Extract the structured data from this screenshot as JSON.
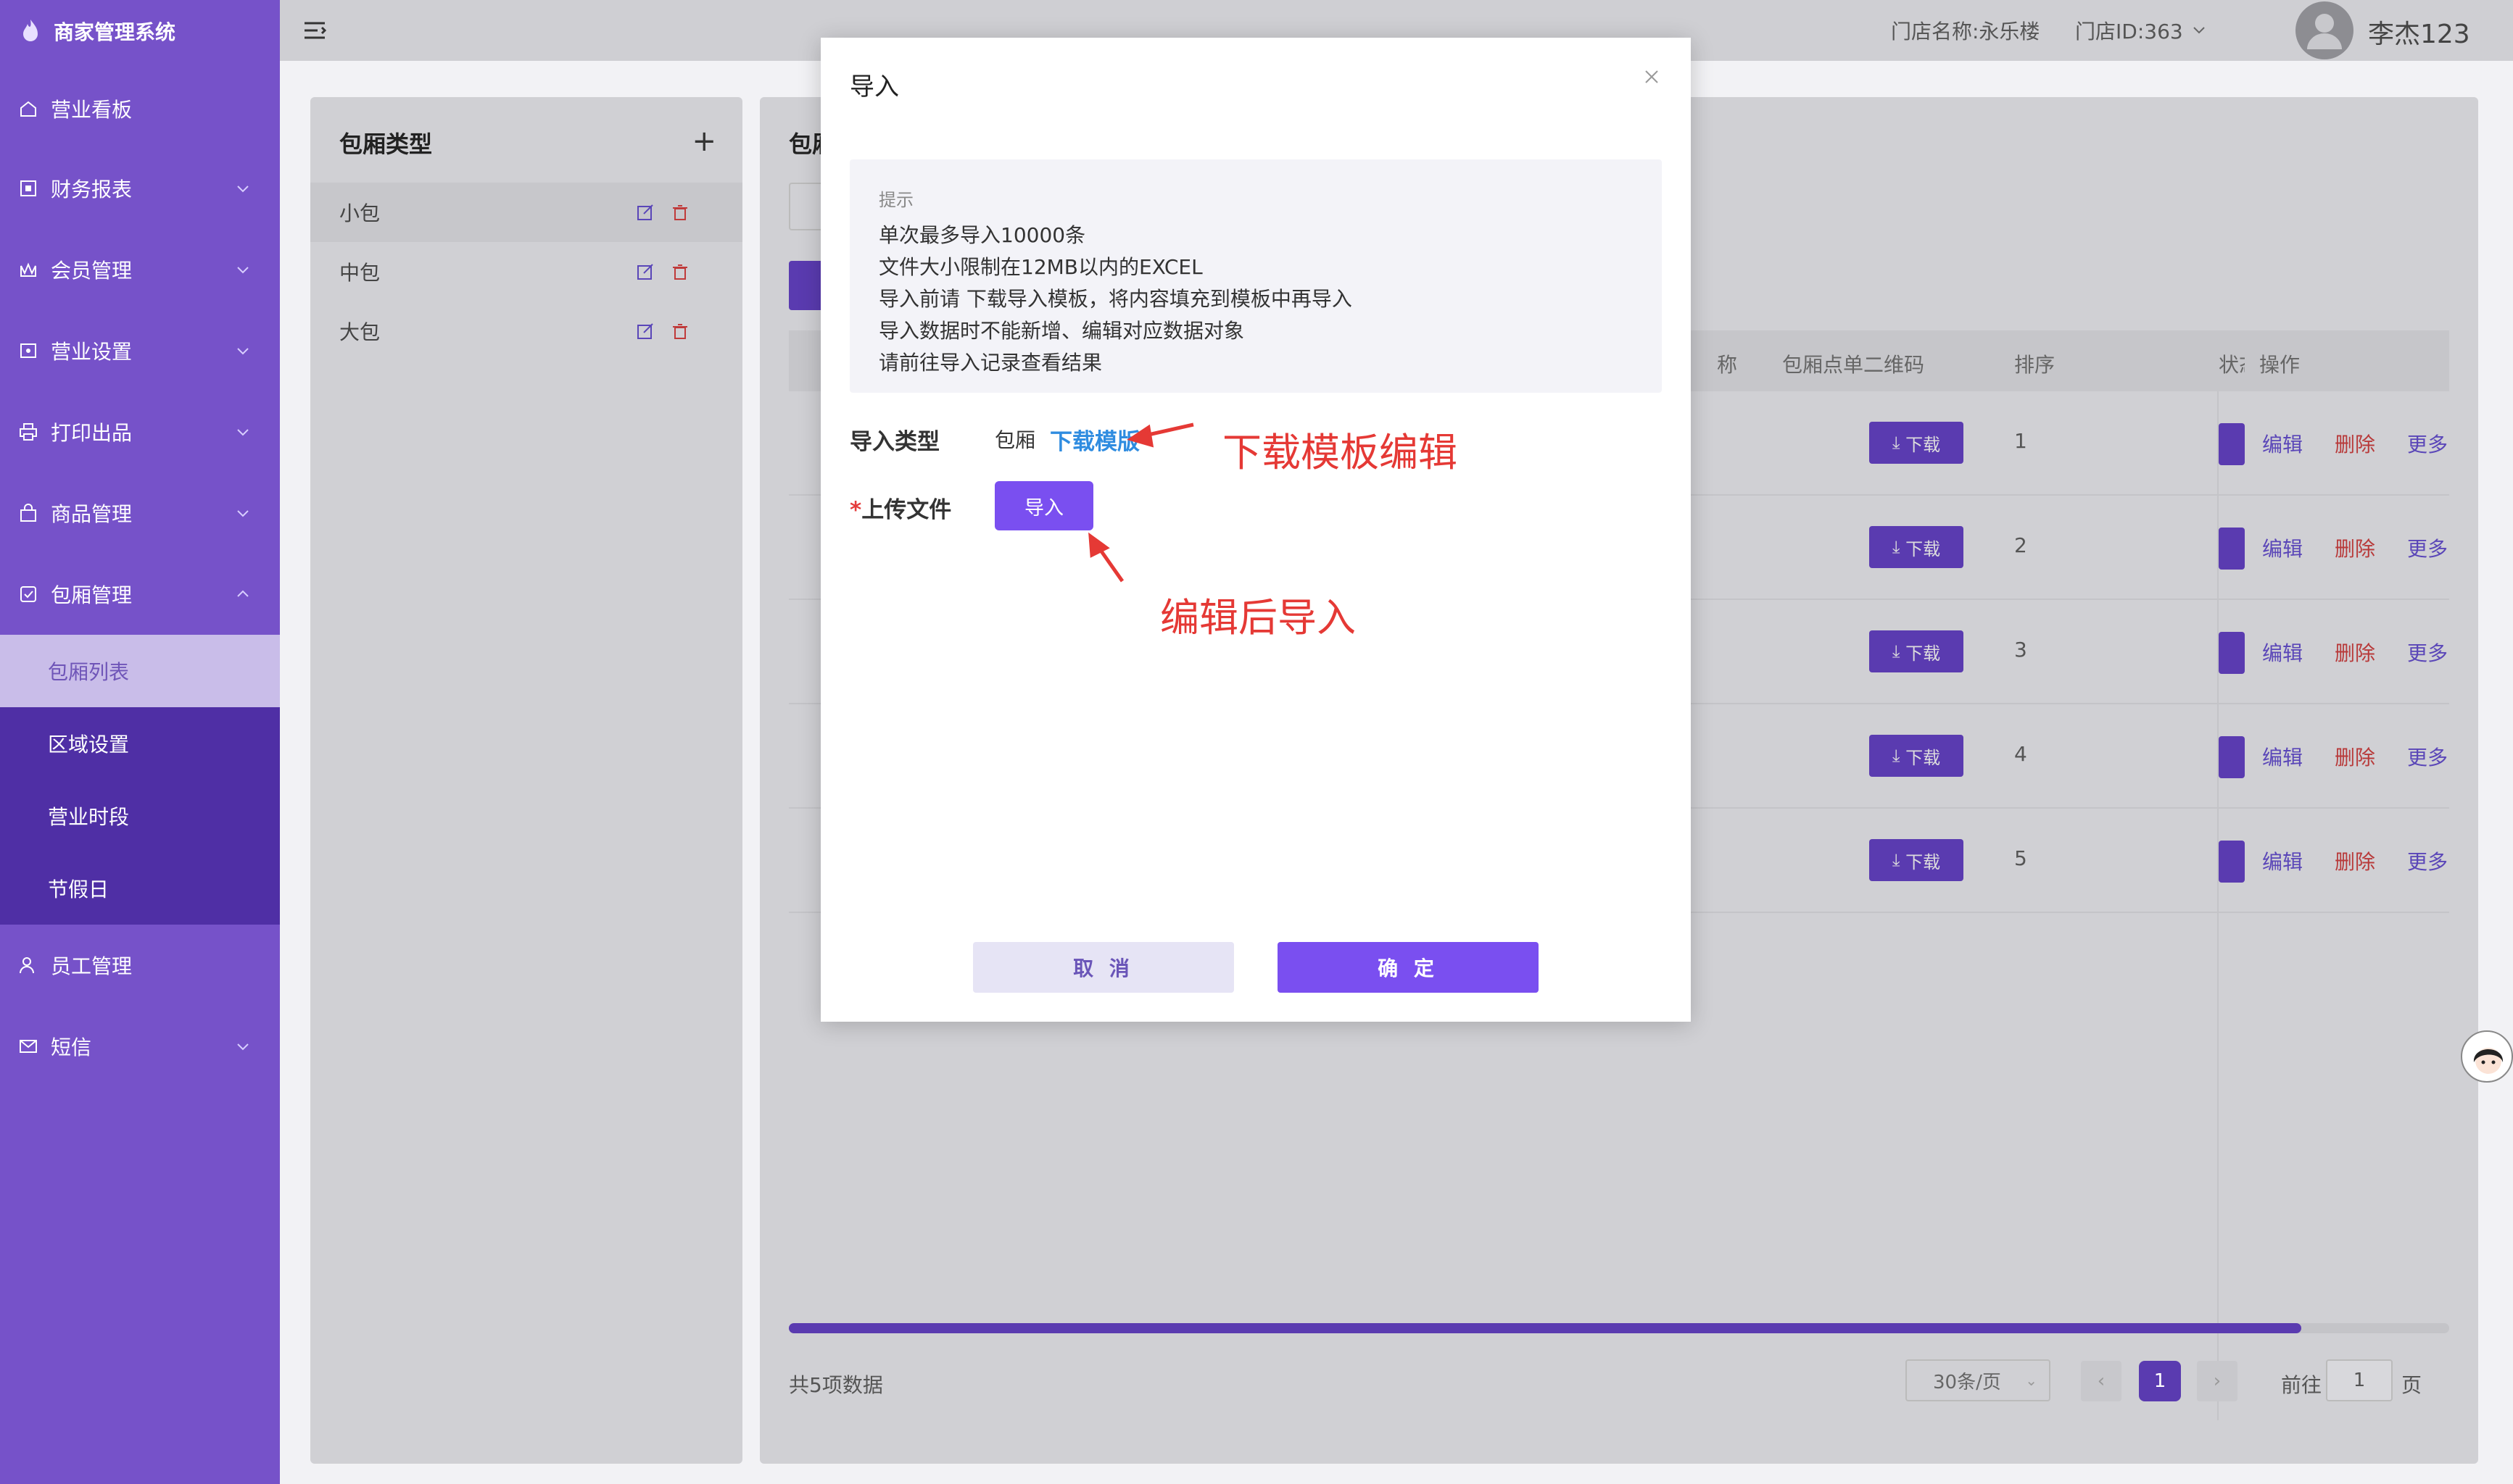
{
  "app": {
    "title": "商家管理系统"
  },
  "sidebar": {
    "items": [
      {
        "label": "营业看板",
        "icon": "dashboard-icon",
        "has_children": false
      },
      {
        "label": "财务报表",
        "icon": "report-icon",
        "has_children": true
      },
      {
        "label": "会员管理",
        "icon": "member-icon",
        "has_children": true
      },
      {
        "label": "营业设置",
        "icon": "settings-icon",
        "has_children": true
      },
      {
        "label": "打印出品",
        "icon": "printer-icon",
        "has_children": true
      },
      {
        "label": "商品管理",
        "icon": "shopping-bag-icon",
        "has_children": true
      },
      {
        "label": "包厢管理",
        "icon": "room-icon",
        "has_children": true,
        "expanded": true
      },
      {
        "label": "员工管理",
        "icon": "user-icon",
        "has_children": false
      },
      {
        "label": "短信",
        "icon": "mail-icon",
        "has_children": true
      }
    ],
    "subitems": [
      {
        "label": "包厢列表",
        "active": true
      },
      {
        "label": "区域设置"
      },
      {
        "label": "营业时段"
      },
      {
        "label": "节假日"
      }
    ]
  },
  "header": {
    "store_name": "门店名称:永乐楼",
    "store_id": "门店ID:363",
    "user_name": "李杰123"
  },
  "left_panel": {
    "title": "包厢类型",
    "types": [
      "小包",
      "中包",
      "大包"
    ]
  },
  "main_panel": {
    "title_partial": "包厢",
    "columns": {
      "qrcode": "包厢点单二维码",
      "sort": "排序",
      "status": "状态",
      "ops": "操作",
      "partial_left": "称"
    },
    "rows": [
      {
        "download": "下载",
        "sort": "1"
      },
      {
        "download": "下载",
        "sort": "2"
      },
      {
        "download": "下载",
        "sort": "3"
      },
      {
        "download": "下载",
        "sort": "4"
      },
      {
        "download": "下载",
        "sort": "5"
      }
    ],
    "op_labels": {
      "edit": "编辑",
      "delete": "删除",
      "more": "更多"
    },
    "pagination": {
      "total": "共5项数据",
      "page_size": "30条/页",
      "current_page": "1",
      "goto_label": "前往",
      "goto_value": "1",
      "page_unit": "页"
    }
  },
  "dialog": {
    "title": "导入",
    "tip_title": "提示",
    "tips": [
      "单次最多导入10000条",
      "文件大小限制在12MB以内的EXCEL",
      "导入前请 下载导入模板，将内容填充到模板中再导入",
      "导入数据时不能新增、编辑对应数据对象",
      "请前往导入记录查看结果"
    ],
    "import_type_label": "导入类型",
    "import_type_value": "包厢",
    "download_template": "下载模版",
    "upload_label": "上传文件",
    "required_mark": "*",
    "import_button": "导入",
    "cancel": "取 消",
    "confirm": "确 定"
  },
  "annotations": {
    "download_note": "下载模板编辑",
    "import_note": "编辑后导入",
    "color": "#e53935"
  },
  "colors": {
    "sidebar": "#7652c9",
    "sidebar_sub": "#4f2fa5",
    "accent": "#7a4ff0",
    "link": "#2f8ce0",
    "danger": "#e43c3c"
  }
}
